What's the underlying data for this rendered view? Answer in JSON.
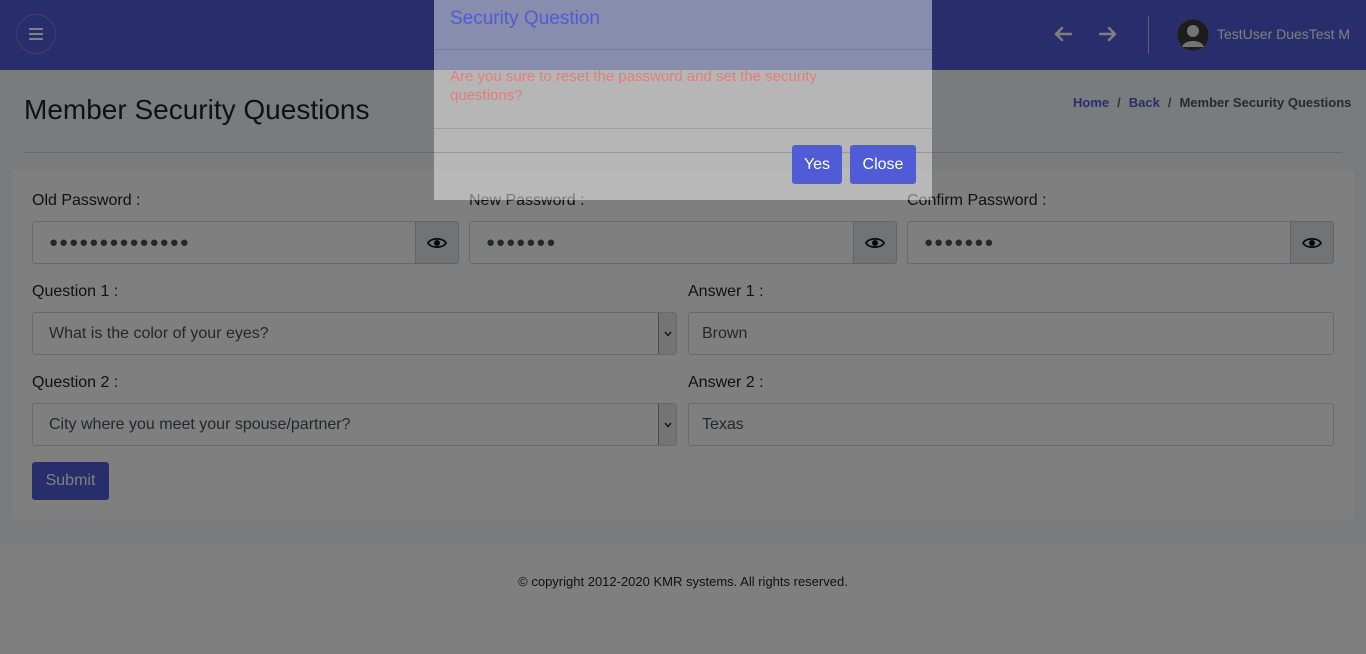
{
  "header": {
    "user_name": "TestUser DuesTest M",
    "menu_icon": "hamburger-icon",
    "back_icon": "arrow-left-icon",
    "forward_icon": "arrow-right-icon",
    "avatar_icon": "user-avatar-icon",
    "brand_color": "#4f5cd6"
  },
  "page": {
    "title": "Member Security Questions",
    "breadcrumb": [
      {
        "label": "Home"
      },
      {
        "label": "Back"
      },
      {
        "label": "Member Security Questions"
      }
    ],
    "breadcrumb_separator": "/"
  },
  "form": {
    "old_password": {
      "label": "Old Password :",
      "value": "●●●●●●●●●●●●●●"
    },
    "new_password": {
      "label": "New Password :",
      "value": "●●●●●●●"
    },
    "confirm_password": {
      "label": "Confirm Password :",
      "value": "●●●●●●●"
    },
    "question1": {
      "label": "Question 1 :",
      "value": "What is the color of your eyes?"
    },
    "answer1": {
      "label": "Answer 1 :",
      "value": "Brown"
    },
    "question2": {
      "label": "Question 2 :",
      "value": "City where you meet your spouse/partner?"
    },
    "answer2": {
      "label": "Answer 2 :",
      "value": "Texas"
    },
    "submit_label": "Submit",
    "eye_icon": "eye-icon",
    "dropdown_icon": "chevron-down-icon"
  },
  "footer": {
    "copyright": "© copyright 2012-2020 KMR systems. All rights reserved."
  },
  "modal": {
    "title": "Security Question",
    "message": "Are you sure to reset the password and set the security questions?",
    "yes_label": "Yes",
    "close_label": "Close",
    "message_color": "#e07f78"
  }
}
